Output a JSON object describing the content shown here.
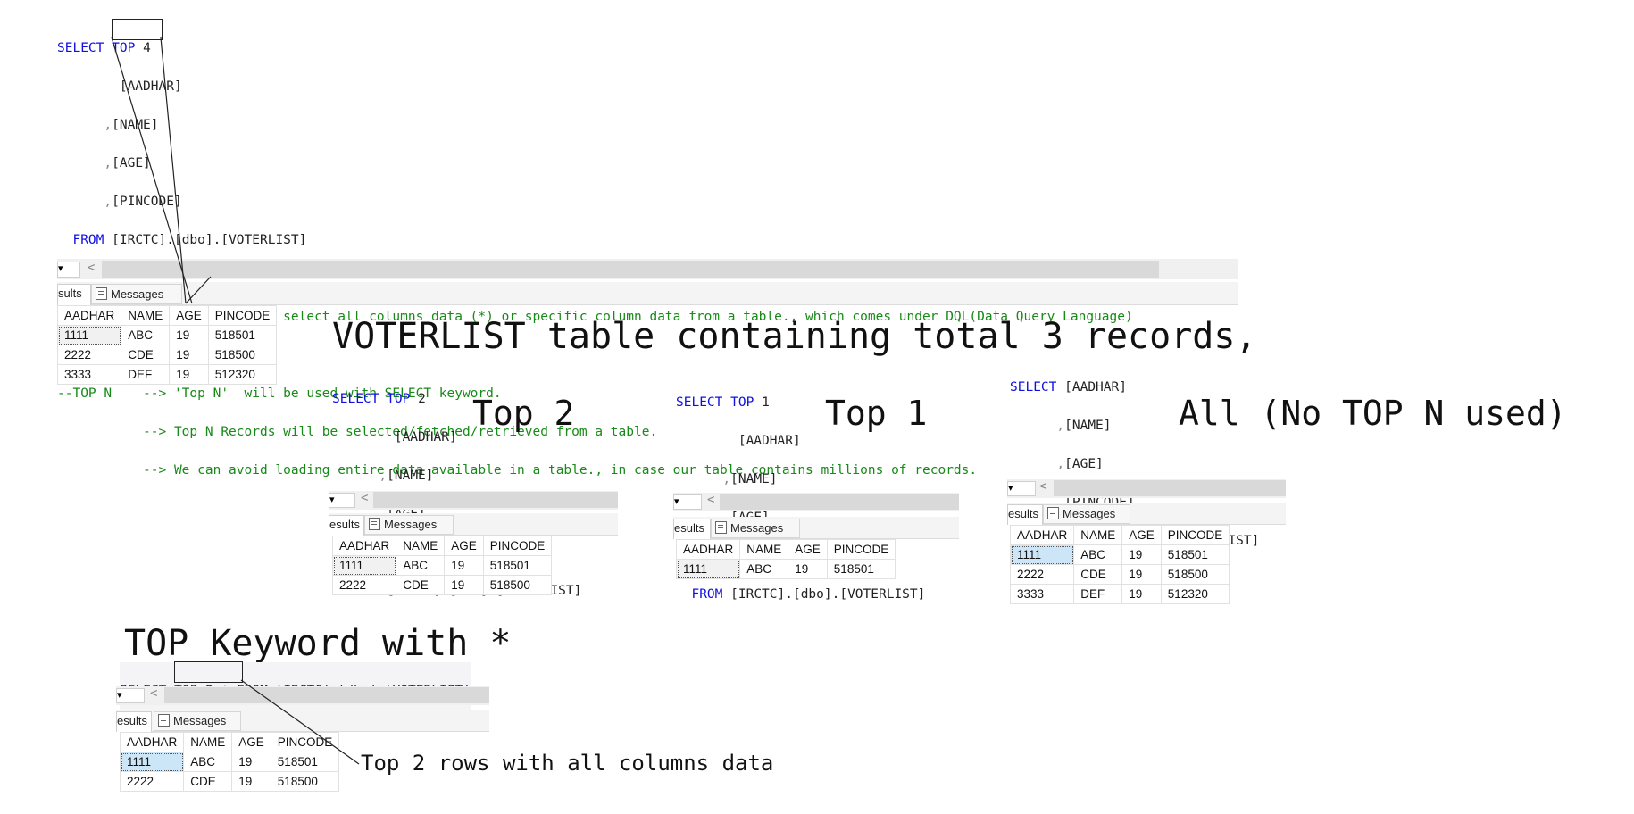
{
  "main_query": {
    "line1": {
      "kw": "SELECT",
      "top": "TOP",
      "n": "4"
    },
    "lines": [
      "[AADHAR]",
      "[NAME]",
      "[AGE]",
      "[PINCODE]"
    ],
    "from_kw": "FROM",
    "from_obj": "[IRCTC].[dbo].[VOTERLIST]"
  },
  "comments": [
    "--SELECT -->  SELECT used to select all columns data (*) or specific column data from a table., which comes under DQL(Data Query Language)",
    "--TOP N    --> 'Top N'  will be used with SELECT keyword.",
    "           --> Top N Records will be selected/fetched/retrieved from a table.",
    "           --> We can avoid loading entire data available in a table., in case our table contains millions of records."
  ],
  "tabs": {
    "results": "sults",
    "results_short": "esults",
    "messages": "Messages"
  },
  "columns": [
    "AADHAR",
    "NAME",
    "AGE",
    "PINCODE"
  ],
  "table_main": [
    [
      "1111",
      "ABC",
      "19",
      "518501"
    ],
    [
      "2222",
      "CDE",
      "19",
      "518500"
    ],
    [
      "3333",
      "DEF",
      "19",
      "512320"
    ]
  ],
  "heading": "VOTERLIST table containing total 3 records,",
  "top2": {
    "kw": "SELECT",
    "top": "TOP",
    "n": "2",
    "label": "Top 2",
    "rows": [
      [
        "1111",
        "ABC",
        "19",
        "518501"
      ],
      [
        "2222",
        "CDE",
        "19",
        "518500"
      ]
    ]
  },
  "top1": {
    "kw": "SELECT",
    "top": "TOP",
    "n": "1",
    "label": "Top 1",
    "rows": [
      [
        "1111",
        "ABC",
        "19",
        "518501"
      ]
    ]
  },
  "all": {
    "kw": "SELECT",
    "label": "All (No TOP N used)",
    "rows": [
      [
        "1111",
        "ABC",
        "19",
        "518501"
      ],
      [
        "2222",
        "CDE",
        "19",
        "518500"
      ],
      [
        "3333",
        "DEF",
        "19",
        "512320"
      ]
    ]
  },
  "star": {
    "heading": "TOP Keyword with *",
    "kw": "SELECT",
    "top": "TOP",
    "n": "2",
    "star": "*",
    "from_kw": "FROM",
    "from_obj": "[IRCTC].[dbo].[VOTERLIST]",
    "rows": [
      [
        "1111",
        "ABC",
        "19",
        "518501"
      ],
      [
        "2222",
        "CDE",
        "19",
        "518500"
      ]
    ],
    "note": "Top 2 rows with all columns data"
  },
  "colors": {
    "keyword": "#1010e0",
    "comment": "#178a17",
    "selection": "#cde6f7"
  }
}
